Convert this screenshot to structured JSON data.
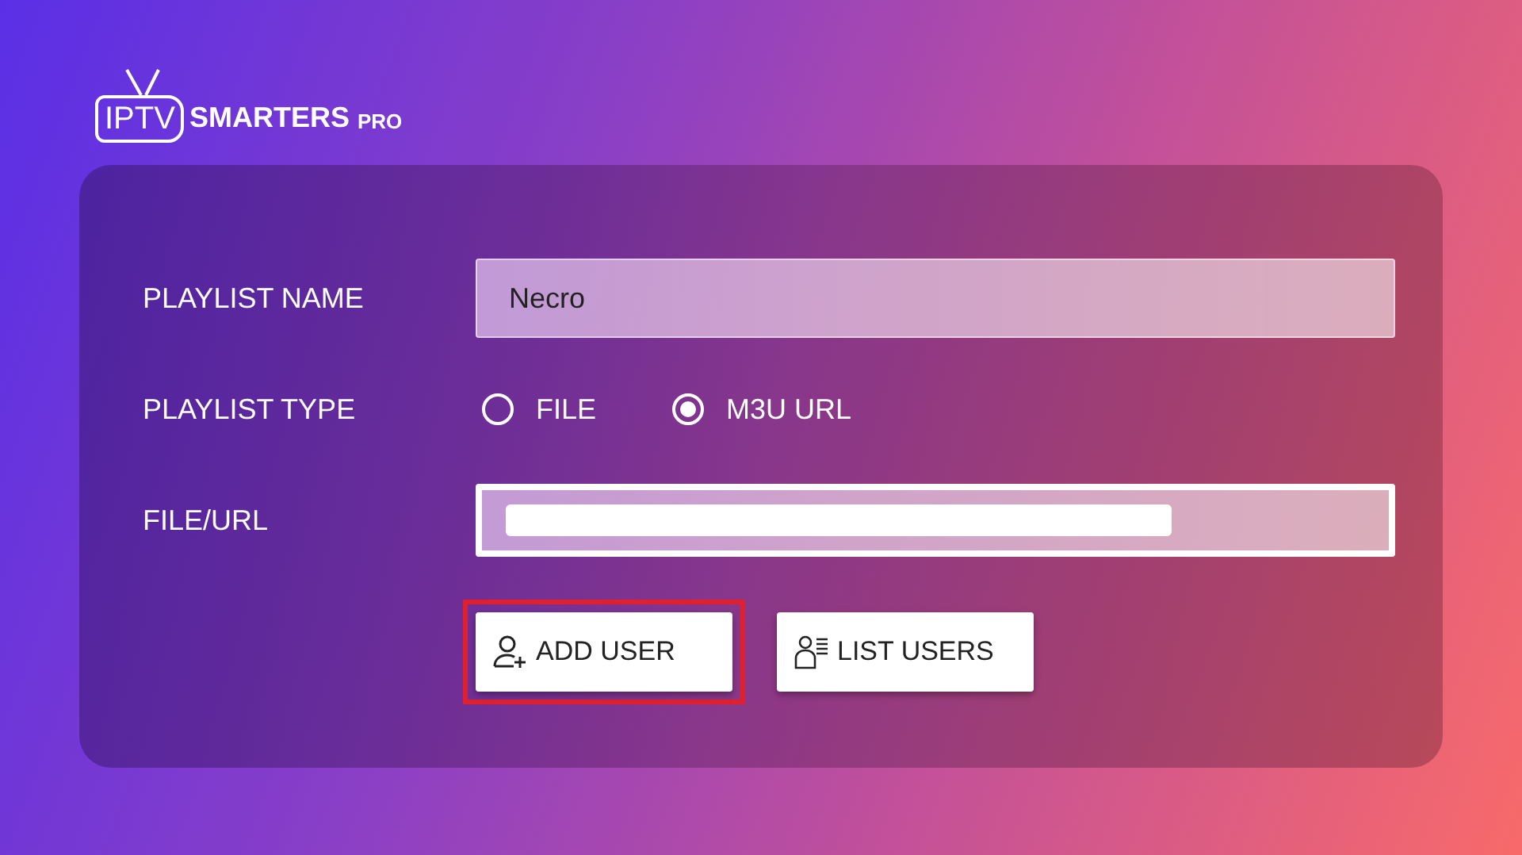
{
  "logo": {
    "prefix": "IPTV",
    "name": "SMARTERS",
    "suffix": "PRO"
  },
  "form": {
    "name_row": {
      "label": "PLAYLIST NAME",
      "value": "Necro",
      "focused": false
    },
    "type_row": {
      "label": "PLAYLIST TYPE",
      "options": [
        {
          "label": "FILE",
          "selected": false
        },
        {
          "label": "M3U URL",
          "selected": true
        }
      ]
    },
    "url_row": {
      "label": "FILE/URL",
      "focused": true,
      "redacted": true
    },
    "buttons": [
      {
        "kind": "add",
        "label": "ADD USER",
        "highlighted": true
      },
      {
        "kind": "list",
        "label": "LIST USERS",
        "highlighted": false
      }
    ]
  }
}
